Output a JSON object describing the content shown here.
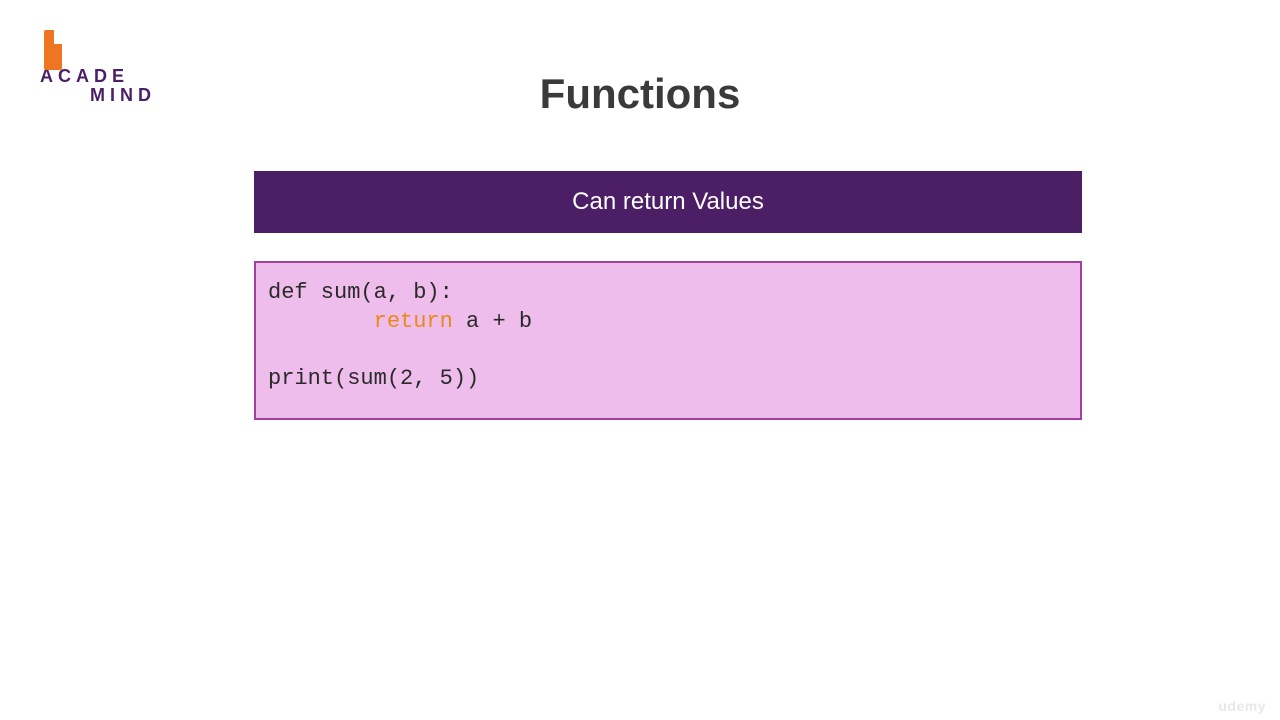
{
  "logo": {
    "line1": "ACADE",
    "line2": "MIND"
  },
  "title": "Functions",
  "banner": "Can return Values",
  "code": {
    "line1_pre": "def sum(a, b):",
    "line2_indent": "        ",
    "line2_keyword": "return",
    "line2_post": " a + b",
    "line3": "",
    "line4": "print(sum(2, 5))"
  },
  "watermark": "udemy"
}
